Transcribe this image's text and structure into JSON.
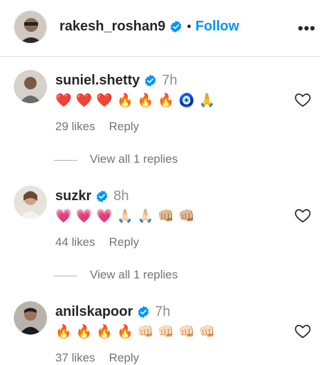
{
  "post": {
    "username": "rakesh_roshan9",
    "separator": "•",
    "follow_label": "Follow",
    "more_label": "•••"
  },
  "comments": [
    {
      "username": "suniel.shetty",
      "time": "7h",
      "emojis": [
        "❤️",
        "❤️",
        "❤️",
        "🔥",
        "🔥",
        "🔥",
        "🧿",
        "🙏"
      ],
      "likes": "29 likes",
      "reply_label": "Reply",
      "view_replies": "View all 1 replies"
    },
    {
      "username": "suzkr",
      "time": "8h",
      "emojis": [
        "💗",
        "💗",
        "💗",
        "🙏🏻",
        "🙏🏻",
        "👊🏼",
        "👊🏼"
      ],
      "likes": "44 likes",
      "reply_label": "Reply",
      "view_replies": "View all 1 replies"
    },
    {
      "username": "anilskapoor",
      "time": "7h",
      "emojis": [
        "🔥",
        "🔥",
        "🔥",
        "🔥",
        "👊🏻",
        "👊🏻",
        "👊🏻",
        "👊🏻"
      ],
      "likes": "37 likes",
      "reply_label": "Reply"
    }
  ],
  "colors": {
    "accent": "#0095f6",
    "verified": "#0095f6",
    "muted": "#737373",
    "divider": "#dbdbdb"
  },
  "icons": [
    "verified-badge-icon",
    "heart-outline-icon",
    "more-options-icon"
  ]
}
